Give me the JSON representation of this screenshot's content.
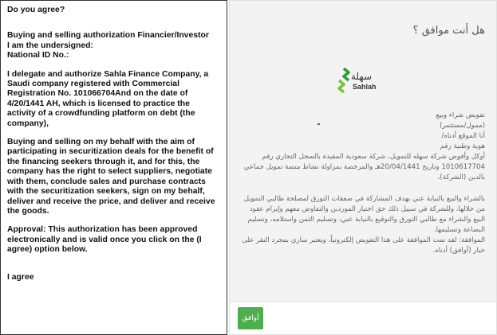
{
  "english": {
    "question": "Do you agree?",
    "para1": [
      "Buying and selling authorization Financier/Investor",
      "I am the undersigned:",
      "National ID No.:"
    ],
    "para2": "I delegate and authorize Sahla Finance Company, a Saudi company registered with Commercial Registration No. 101066704And on the date of 4/20/1441 AH, which is licensed to practice the activity of a crowdfunding platform on debt (the company),",
    "para3": "Buying and selling on my behalf with the aim of participating in securitization deals for the benefit of the financing seekers through it, and for this, the company has the right to select suppliers, negotiate with them, conclude sales and purchase contracts with the securitization seekers, sign on my behalf, deliver and receive the price, and deliver and receive the goods.",
    "para4": "Approval: This authorization has been approved electronically and is valid once you click on the (I agree) option below.",
    "agree": "I agree"
  },
  "arabic": {
    "question": "هل أنت موافق ؟",
    "logo_ar": "سهلة",
    "logo_en": "Sahlah",
    "lines1": [
      "تفويض شراء وبيع",
      "(ممول/مستثمر)",
      "أنا الموقع أدناه/",
      "هوية وطنية رقم"
    ],
    "para2": "أوكل وأفوض شركة سهله للتمويل، شركة سعودية المقيدة بالسجل التجاري رقم 1010617704 وتاريخ 20/04/1441هـ والمرخصة بمزاولة نشاط منصة تمويل جماعي بالدين (الشركة)،",
    "para3": "بالشراء والبيع بالنيابة عني بهدف المشاركة في صفقات التورق لمصلحة طالبي التمويل من خلالها، وللشركة في سبيل ذلك حق اختيار الموردين والتفاوض معهم وإبرام عقود البيع والشراء مع طالبي التورق والتوقيع بالنيابة عني، وتسليم الثمن واستلامه، وتسليم البضاعة وتسليمها.",
    "para4": "الموافقة: لقد تمت الموافقة على هذا التفويض إلكترونياً، ويعتبر ساري بمجرد النقر على خيار (أوافق) أدناه.",
    "agree_button": "أوافق"
  },
  "colors": {
    "button": "#4cae4c",
    "panel_bg": "#f3f3f3"
  }
}
